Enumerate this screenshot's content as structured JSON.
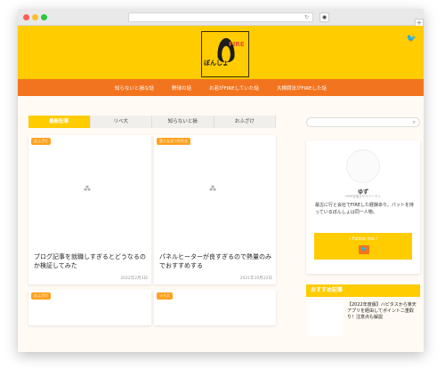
{
  "browser": {
    "reload_icon": "↻",
    "shield_icon": "shield-icon",
    "new_tab": "+"
  },
  "site": {
    "logo_main": "ぽんしょ",
    "logo_fire": "FIRE",
    "twitter_icon": "twitter-icon",
    "nav": [
      "知らないと損な話",
      "野球の話",
      "お若がFIREしていた話",
      "大検問法がFIREした話"
    ]
  },
  "tabs": [
    "最新記事",
    "リベ大",
    "知らないと損",
    "おふざけ"
  ],
  "search": {
    "placeholder": "",
    "icon": "search-icon"
  },
  "cards": [
    {
      "badge": "おふざけ",
      "title": "ブログ記事を就職しすぎるとどうなるのか検証してみた",
      "date": "2022年2月3日"
    },
    {
      "badge": "賢くなるつかれる",
      "title": "パネルヒーターが良すぎるので熱量のみでおすすめする",
      "date": "2021年10月22日"
    },
    {
      "badge": "おふざけ",
      "title": "",
      "date": ""
    },
    {
      "badge": "リベ大",
      "title": "",
      "date": ""
    }
  ],
  "profile": {
    "name": "ゆず",
    "subtitle": "FIRE目指すサラリーマン",
    "description": "最古に行と会社でFIREした経験あり。パットを持っているぽんしょは同一人物。",
    "follow_label": "\\ Follow me /",
    "follow_icon": "twitter-icon"
  },
  "recommended": {
    "heading": "おすすめ記事",
    "items": [
      {
        "title": "【2022年度版】ハピタスから楽天アプリを経由してポイント二重取り！注意点も解説"
      }
    ]
  },
  "colors": {
    "accent": "#ffcc00",
    "nav": "#f3741e",
    "badge": "#ffa21f"
  }
}
